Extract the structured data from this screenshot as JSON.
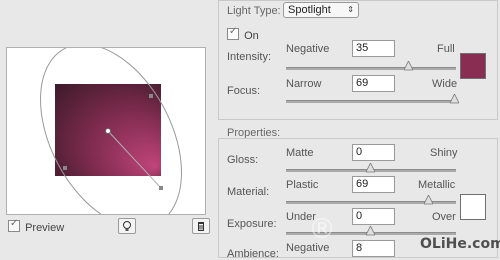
{
  "light": {
    "type_label": "Light Type:",
    "type_value": "Spotlight",
    "on_label": "On",
    "on_checked": true,
    "intensity": {
      "label": "Intensity:",
      "min_label": "Negative",
      "max_label": "Full",
      "value": "35",
      "level": 0.68
    },
    "focus": {
      "label": "Focus:",
      "min_label": "Narrow",
      "max_label": "Wide",
      "value": "69",
      "level": 0.9
    },
    "color": "#8a2d52"
  },
  "properties": {
    "title": "Properties:",
    "gloss": {
      "label": "Gloss:",
      "min_label": "Matte",
      "max_label": "Shiny",
      "value": "0",
      "level": 0.5
    },
    "material": {
      "label": "Material:",
      "min_label": "Plastic",
      "max_label": "Metallic",
      "value": "69",
      "level": 0.85
    },
    "exposure": {
      "label": "Exposure:",
      "min_label": "Under",
      "max_label": "Over",
      "value": "0",
      "level": 0.5
    },
    "ambience": {
      "label": "Ambience:",
      "min_label": "Negative",
      "value": "8"
    },
    "swatch_color": "#ffffff"
  },
  "preview": {
    "label": "Preview",
    "checked": true,
    "image_color_dark": "#3a1a28",
    "image_color_light": "#c0447a"
  },
  "toolbar": {
    "lightbulb_icon": "lightbulb-icon",
    "trash_icon": "trash-icon"
  },
  "watermark": {
    "logo_text": "®",
    "site": "OLiHe.com"
  }
}
